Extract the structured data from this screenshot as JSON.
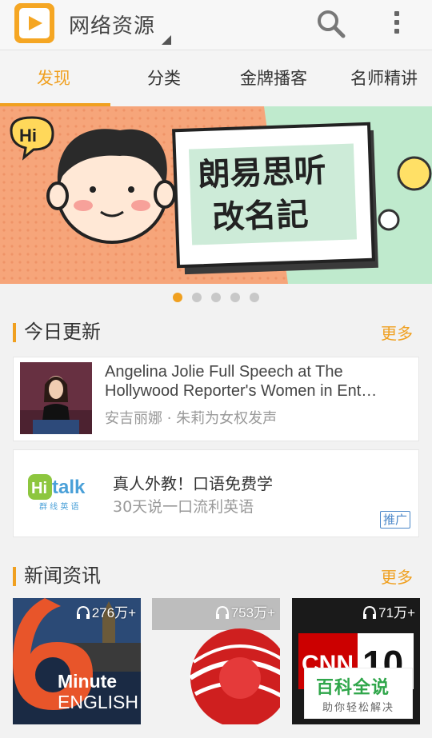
{
  "header": {
    "title": "网络资源"
  },
  "tabs": [
    {
      "label": "发现"
    },
    {
      "label": "分类"
    },
    {
      "label": "金牌播客"
    },
    {
      "label": "名师精讲"
    }
  ],
  "banner": {
    "hi_text": "Hi",
    "card_line1": "朗易思听",
    "card_line2": "改名記",
    "dots_total": 5,
    "dots_active": 1
  },
  "today": {
    "title": "今日更新",
    "more": "更多",
    "item": {
      "title_line1": "Angelina Jolie Full Speech at The",
      "title_line2": "Hollywood Reporter's Women in Ent…",
      "subtitle": "安吉丽娜 · 朱莉为女权发声"
    },
    "ad": {
      "logo_brand": "talk",
      "logo_hi": "Hi",
      "logo_sub": "群 线 英 语",
      "title": "真人外教！口语免费学",
      "subtitle": "30天说一口流利英语",
      "badge": "推广"
    }
  },
  "news": {
    "title": "新闻资讯",
    "more": "更多",
    "items": [
      {
        "count": "276万+",
        "line1": "Minute",
        "line2": "ENGLISH"
      },
      {
        "count": "753万+"
      },
      {
        "count": "71万+",
        "logo": "CNN",
        "number": "10"
      }
    ]
  },
  "watermark": {
    "title": "百科全说",
    "subtitle": "助你轻松解决"
  },
  "colors": {
    "accent": "#f0a020",
    "banner_bg": "#f6a57a",
    "ad_badge": "#4a86c8"
  }
}
